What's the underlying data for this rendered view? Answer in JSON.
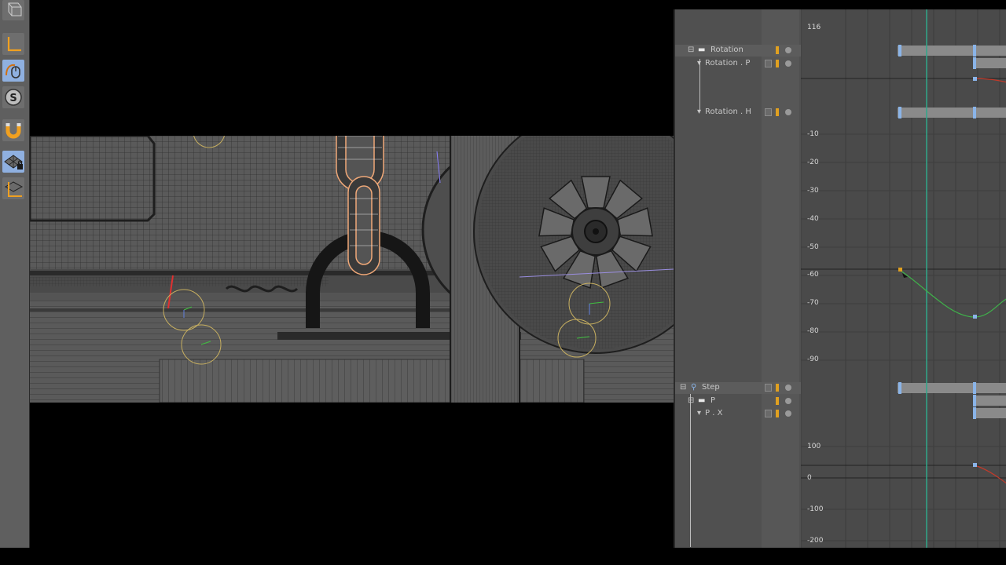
{
  "toolstrip": {
    "tools": [
      {
        "name": "cube-tool",
        "icon": "cube-icon",
        "active": false
      },
      {
        "name": "axis-tool",
        "icon": "axis-icon",
        "active": false
      },
      {
        "name": "mouse-tool",
        "icon": "mouse-icon",
        "active": true
      },
      {
        "name": "snap-s-tool",
        "icon": "s-icon",
        "active": false
      },
      {
        "name": "magnet-tool",
        "icon": "magnet-icon",
        "active": false
      },
      {
        "name": "lock-grid-tool",
        "icon": "grid-lock-icon",
        "active": true
      },
      {
        "name": "workplane-tool",
        "icon": "workplane-icon",
        "active": false
      }
    ]
  },
  "timeline": {
    "tracks": [
      {
        "id": "rotation",
        "label": "Rotation",
        "level": 1,
        "expander": "⊟",
        "icon": "folder-icon"
      },
      {
        "id": "rotation-p",
        "label": "Rotation . P",
        "level": 2,
        "expander": "",
        "icon": "track-icon"
      },
      {
        "id": "rotation-h",
        "label": "Rotation . H",
        "level": 2,
        "expander": "",
        "icon": "track-icon"
      },
      {
        "id": "step",
        "label": "Step",
        "level": 0,
        "expander": "⊟",
        "icon": "wrench-icon"
      },
      {
        "id": "p",
        "label": "P",
        "level": 1,
        "expander": "⊟",
        "icon": "folder-icon"
      },
      {
        "id": "p-x",
        "label": "P . X",
        "level": 2,
        "expander": "",
        "icon": "track-icon"
      }
    ],
    "y_axis_upper": [
      "116",
      "-10",
      "-20",
      "-30",
      "-40",
      "-50",
      "-60",
      "-70",
      "-80",
      "-90"
    ],
    "y_axis_lower": [
      "100",
      "0",
      "-100",
      "-200"
    ]
  },
  "colors": {
    "panel": "#4b4b4b",
    "curve_green": "#3fb24a",
    "curve_red": "#c23a2a",
    "playhead": "#2fa88a",
    "key_orange": "#e0a020",
    "key_blue": "#8ab4e8",
    "selection_outline": "#f0a878"
  }
}
